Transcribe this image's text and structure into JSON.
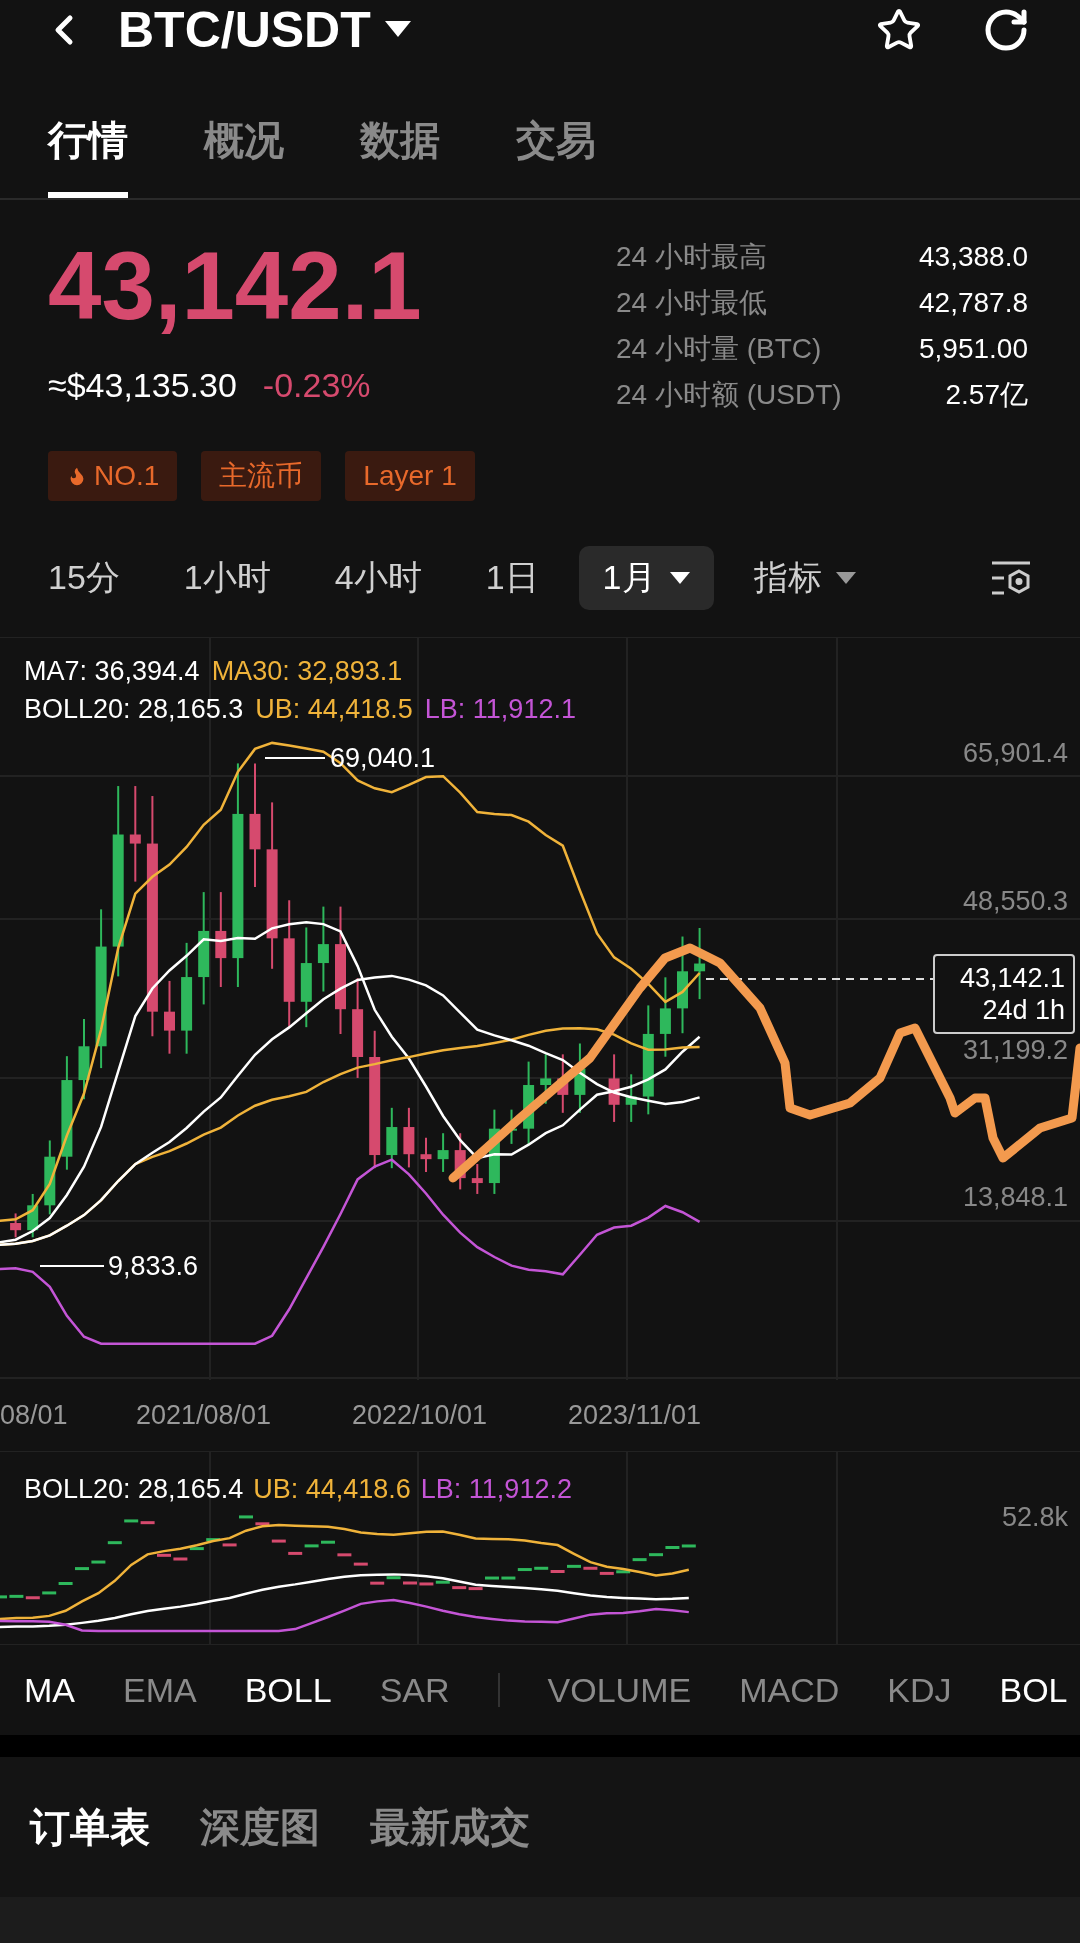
{
  "header": {
    "title": "BTC/USDT"
  },
  "tabs": [
    {
      "label": "行情",
      "selected": true
    },
    {
      "label": "概况",
      "selected": false
    },
    {
      "label": "数据",
      "selected": false
    },
    {
      "label": "交易",
      "selected": false
    }
  ],
  "price": {
    "last": "43,142.1",
    "usd": "≈$43,135.30",
    "change": "-0.23%"
  },
  "stats": [
    {
      "label": "24 小时最高",
      "value": "43,388.0"
    },
    {
      "label": "24 小时最低",
      "value": "42,787.8"
    },
    {
      "label": "24 小时量 (BTC)",
      "value": "5,951.00"
    },
    {
      "label": "24 小时额 (USDT)",
      "value": "2.57亿"
    }
  ],
  "tags": [
    {
      "label": "NO.1",
      "kind": "hot"
    },
    {
      "label": "主流币",
      "kind": "plain"
    },
    {
      "label": "Layer 1",
      "kind": "plain"
    }
  ],
  "intervals": [
    {
      "label": "15分",
      "selected": false,
      "kind": "plain"
    },
    {
      "label": "1小时",
      "selected": false,
      "kind": "plain"
    },
    {
      "label": "4小时",
      "selected": false,
      "kind": "plain"
    },
    {
      "label": "1日",
      "selected": false,
      "kind": "plain"
    },
    {
      "label": "1月",
      "selected": true,
      "kind": "dropdown"
    },
    {
      "label": "指标",
      "selected": false,
      "kind": "dropdown"
    }
  ],
  "chart": {
    "legend": [
      [
        {
          "text": "MA7: 36,394.4",
          "color": "#ffffff"
        },
        {
          "text": "MA30: 32,893.1",
          "color": "#f0b33a"
        }
      ],
      [
        {
          "text": "BOLL20: 28,165.3",
          "color": "#ffffff"
        },
        {
          "text": "UB: 44,418.5",
          "color": "#f0b33a"
        },
        {
          "text": "LB: 11,912.1",
          "color": "#c455d6"
        }
      ]
    ],
    "price_labels": [
      "65,901.4",
      "48,550.3",
      "31,199.2",
      "13,848.1"
    ],
    "high_label": "69,040.1",
    "low_label": "9,833.6",
    "last_price_tag": {
      "price": "43,142.1",
      "countdown": "24d 1h"
    },
    "dates": [
      "08/01",
      "2021/08/01",
      "2022/10/01",
      "2023/11/01"
    ]
  },
  "sub_chart": {
    "legend": [
      {
        "text": "BOLL20: 28,165.4",
        "color": "#ffffff"
      },
      {
        "text": "UB: 44,418.6",
        "color": "#f0b33a"
      },
      {
        "text": "LB: 11,912.2",
        "color": "#c455d6"
      }
    ],
    "scale": "52.8k"
  },
  "main_indicators": [
    {
      "label": "MA",
      "selected": true
    },
    {
      "label": "EMA",
      "selected": false
    },
    {
      "label": "BOLL",
      "selected": true
    },
    {
      "label": "SAR",
      "selected": false
    }
  ],
  "sub_indicators": [
    {
      "label": "VOLUME",
      "selected": false
    },
    {
      "label": "MACD",
      "selected": false
    },
    {
      "label": "KDJ",
      "selected": false
    },
    {
      "label": "BOL",
      "selected": true
    }
  ],
  "bottom_tabs": [
    {
      "label": "订单表",
      "selected": true
    },
    {
      "label": "深度图",
      "selected": false
    },
    {
      "label": "最新成交",
      "selected": false
    }
  ]
}
